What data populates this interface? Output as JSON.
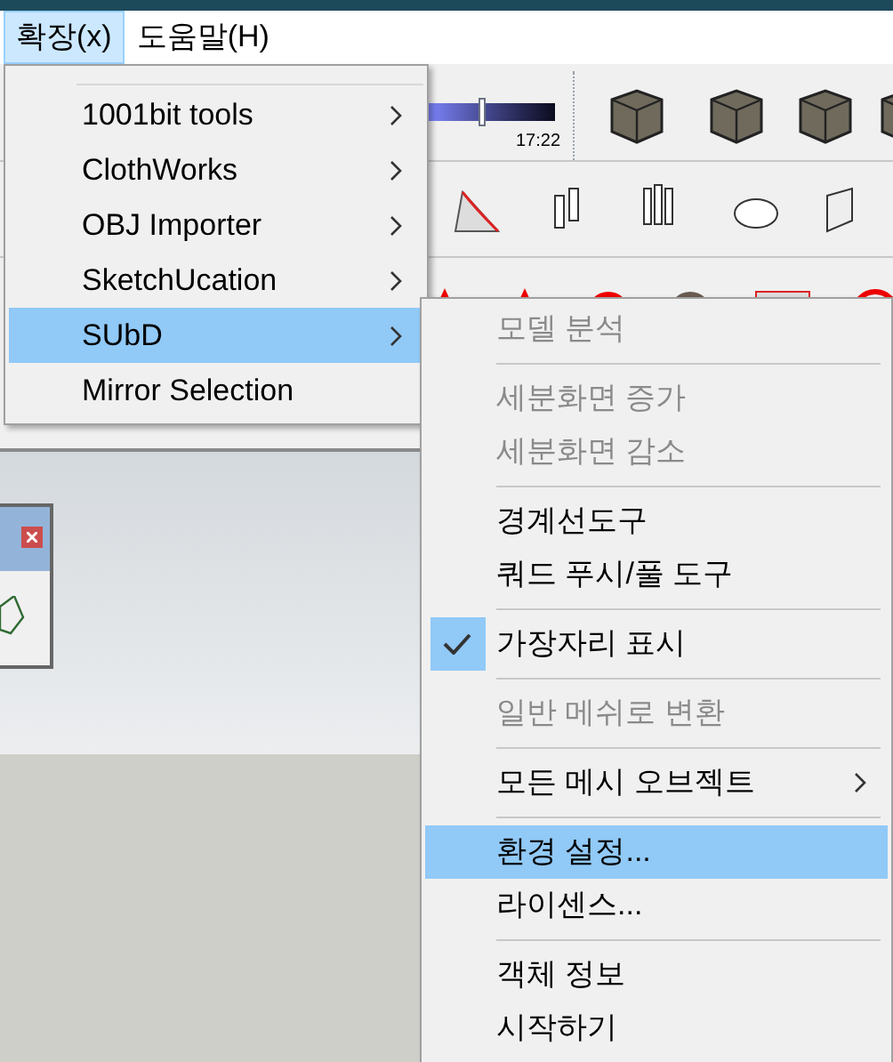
{
  "menu_bar": [
    {
      "label": "확장(x)",
      "selected": true
    },
    {
      "label": "도움말(H)",
      "selected": false
    }
  ],
  "toolbar": {
    "time_slider": {
      "level": 0.4,
      "reading": "17:22"
    }
  },
  "extensions_menu": [
    {
      "label": "1001bit tools",
      "has_submenu": true,
      "selected": false
    },
    {
      "label": "ClothWorks",
      "has_submenu": true,
      "selected": false
    },
    {
      "label": "OBJ Importer",
      "has_submenu": true,
      "selected": false
    },
    {
      "label": "SketchUcation",
      "has_submenu": true,
      "selected": false
    },
    {
      "label": "SUbD",
      "has_submenu": true,
      "selected": true
    },
    {
      "label": "Mirror Selection",
      "has_submenu": false,
      "selected": false
    }
  ],
  "subd_menu": [
    [
      {
        "label": "모델 분석",
        "disabled": true,
        "checked": false,
        "has_submenu": false,
        "selected": false
      }
    ],
    [
      {
        "label": "세분화면 증가",
        "disabled": true,
        "checked": false,
        "has_submenu": false,
        "selected": false
      },
      {
        "label": "세분화면 감소",
        "disabled": true,
        "checked": false,
        "has_submenu": false,
        "selected": false
      }
    ],
    [
      {
        "label": "경계선도구",
        "disabled": false,
        "checked": false,
        "has_submenu": false,
        "selected": false
      },
      {
        "label": "쿼드 푸시/풀 도구",
        "disabled": false,
        "checked": false,
        "has_submenu": false,
        "selected": false
      }
    ],
    [
      {
        "label": "가장자리 표시",
        "disabled": false,
        "checked": true,
        "has_submenu": false,
        "selected": false
      }
    ],
    [
      {
        "label": "일반 메쉬로 변환",
        "disabled": true,
        "checked": false,
        "has_submenu": false,
        "selected": false
      }
    ],
    [
      {
        "label": "모든 메시 오브젝트",
        "disabled": false,
        "checked": false,
        "has_submenu": true,
        "selected": false
      }
    ],
    [
      {
        "label": "환경 설정...",
        "disabled": false,
        "checked": false,
        "has_submenu": false,
        "selected": true
      },
      {
        "label": "라이센스...",
        "disabled": false,
        "checked": false,
        "has_submenu": false,
        "selected": false
      }
    ],
    [
      {
        "label": "객체 정보",
        "disabled": false,
        "checked": false,
        "has_submenu": false,
        "selected": false
      },
      {
        "label": "시작하기",
        "disabled": false,
        "checked": false,
        "has_submenu": false,
        "selected": false
      }
    ]
  ]
}
